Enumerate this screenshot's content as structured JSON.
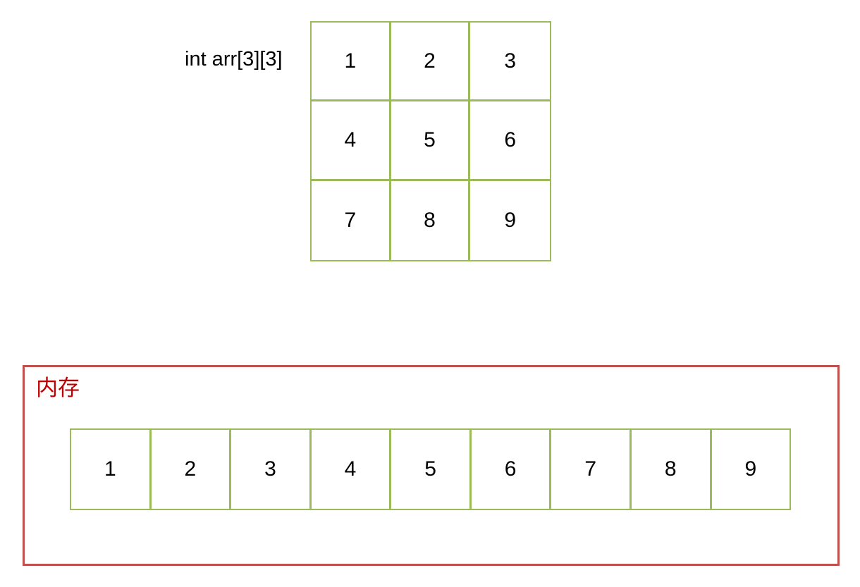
{
  "array": {
    "label": "int arr[3][3]",
    "cells": [
      "1",
      "2",
      "3",
      "4",
      "5",
      "6",
      "7",
      "8",
      "9"
    ],
    "border_color": "#9bbb59"
  },
  "memory": {
    "label": "内存",
    "label_color": "#c00000",
    "border_color": "#c0504d",
    "cells": [
      "1",
      "2",
      "3",
      "4",
      "5",
      "6",
      "7",
      "8",
      "9"
    ]
  }
}
